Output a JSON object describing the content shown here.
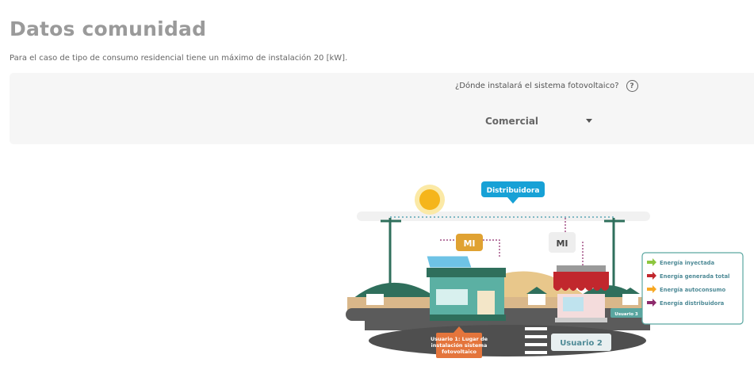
{
  "page": {
    "title": "Datos comunidad",
    "subtitle": "Para el caso de tipo de consumo residencial tiene un máximo de instalación 20 [kW]."
  },
  "installation": {
    "question": "¿Dónde instalará el sistema fotovoltaico?",
    "help_icon": "question-circle-icon",
    "selected": "Comercial"
  },
  "illustration": {
    "distributor_label": "Distribuidora",
    "meter_label_1": "MI",
    "meter_label_2": "MI",
    "user1_label_line1": "Usuario 1: Lugar de",
    "user1_label_line2": "instalación sistema",
    "user1_label_line3": "fotovoltaico",
    "user2_label": "Usuario 2",
    "user3_label": "Usuario 3",
    "legend": [
      {
        "label": "Energía inyectada",
        "color": "#8dc63f"
      },
      {
        "label": "Energía generada total",
        "color": "#c1272d"
      },
      {
        "label": "Energía autoconsumo",
        "color": "#f7a823"
      },
      {
        "label": "Energía distribuidora",
        "color": "#8e2a6c"
      }
    ]
  }
}
